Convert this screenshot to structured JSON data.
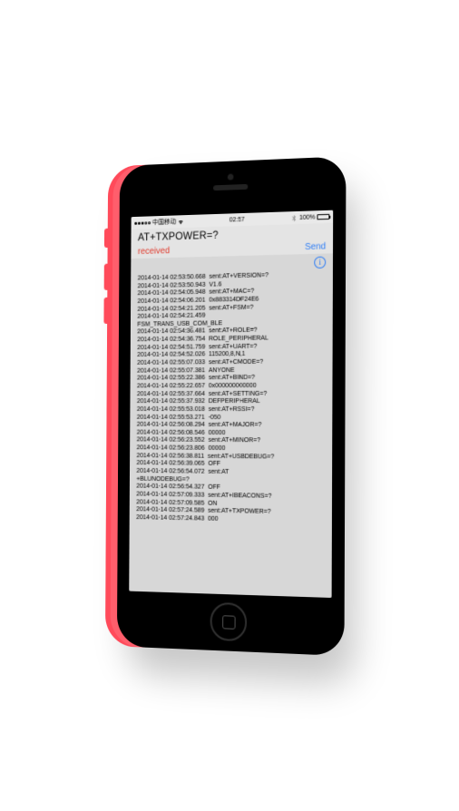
{
  "status": {
    "carrier": "中国移动",
    "time": "02:57",
    "battery_pct": "100%"
  },
  "header": {
    "title": "AT+TXPOWER=?",
    "received_label": "received",
    "send_label": "Send"
  },
  "log": [
    {
      "ts": "2014-01-14 02:53:50.668",
      "msg": "sent:AT+VERSION=?"
    },
    {
      "ts": "2014-01-14 02:53:50.943",
      "msg": "V1.6"
    },
    {
      "ts": "2014-01-14 02:54:05.948",
      "msg": "sent:AT+MAC=?"
    },
    {
      "ts": "2014-01-14 02:54:06.201",
      "msg": "0x883314DF24E6"
    },
    {
      "ts": "2014-01-14 02:54:21.205",
      "msg": "sent:AT+FSM=?"
    },
    {
      "ts": "2014-01-14 02:54:21.459",
      "msg": "",
      "cont": "FSM_TRANS_USB_COM_BLE"
    },
    {
      "ts": "2014-01-14 02:54:36.481",
      "msg": "sent:AT+ROLE=?"
    },
    {
      "ts": "2014-01-14 02:54:36.754",
      "msg": "ROLE_PERIPHERAL"
    },
    {
      "ts": "2014-01-14 02:54:51.759",
      "msg": "sent:AT+UART=?"
    },
    {
      "ts": "2014-01-14 02:54:52.026",
      "msg": "115200,8,N,1"
    },
    {
      "ts": "2014-01-14 02:55:07.033",
      "msg": "sent:AT+CMODE=?"
    },
    {
      "ts": "2014-01-14 02:55:07.381",
      "msg": "ANYONE"
    },
    {
      "ts": "2014-01-14 02:55:22.386",
      "msg": "sent:AT+BIND=?"
    },
    {
      "ts": "2014-01-14 02:55:22.657",
      "msg": "0x000000000000"
    },
    {
      "ts": "2014-01-14 02:55:37.664",
      "msg": "sent:AT+SETTING=?"
    },
    {
      "ts": "2014-01-14 02:55:37.932",
      "msg": "DEFPERIPHERAL"
    },
    {
      "ts": "2014-01-14 02:55:53.018",
      "msg": "sent:AT+RSSI=?"
    },
    {
      "ts": "2014-01-14 02:55:53.271",
      "msg": "-050"
    },
    {
      "ts": "2014-01-14 02:56:08.294",
      "msg": "sent:AT+MAJOR=?"
    },
    {
      "ts": "2014-01-14 02:56:08.546",
      "msg": "00000"
    },
    {
      "ts": "2014-01-14 02:56:23.552",
      "msg": "sent:AT+MINOR=?"
    },
    {
      "ts": "2014-01-14 02:56:23.806",
      "msg": "00000"
    },
    {
      "ts": "2014-01-14 02:56:38.811",
      "msg": "sent:AT+USBDEBUG=?"
    },
    {
      "ts": "2014-01-14 02:56:39.065",
      "msg": "OFF"
    },
    {
      "ts": "2014-01-14 02:56:54.072",
      "msg": "sent:AT",
      "cont": "+BLUNODEBUG=?"
    },
    {
      "ts": "2014-01-14 02:56:54.327",
      "msg": "OFF"
    },
    {
      "ts": "2014-01-14 02:57:09.333",
      "msg": "sent:AT+IBEACONS=?"
    },
    {
      "ts": "2014-01-14 02:57:09.585",
      "msg": "ON"
    },
    {
      "ts": "2014-01-14 02:57:24.589",
      "msg": "sent:AT+TXPOWER=?"
    },
    {
      "ts": "2014-01-14 02:57:24.843",
      "msg": "000"
    }
  ]
}
